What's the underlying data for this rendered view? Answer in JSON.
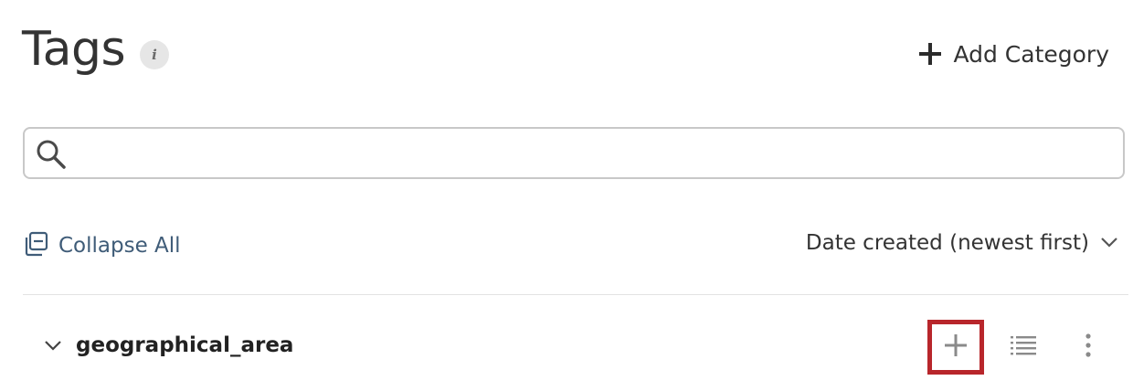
{
  "header": {
    "title": "Tags",
    "info_icon_glyph": "i",
    "add_category_label": "Add Category"
  },
  "search": {
    "value": "",
    "placeholder": ""
  },
  "controls": {
    "collapse_all_label": "Collapse All",
    "sort_label": "Date created (newest first)"
  },
  "categories": [
    {
      "name": "geographical_area",
      "expanded": true,
      "actions": [
        "plus-icon",
        "list-icon",
        "more-vertical-icon"
      ]
    }
  ],
  "colors": {
    "link": "#3f5c78",
    "highlight_border": "#b8262b",
    "icon_gray": "#8a8a8a"
  }
}
